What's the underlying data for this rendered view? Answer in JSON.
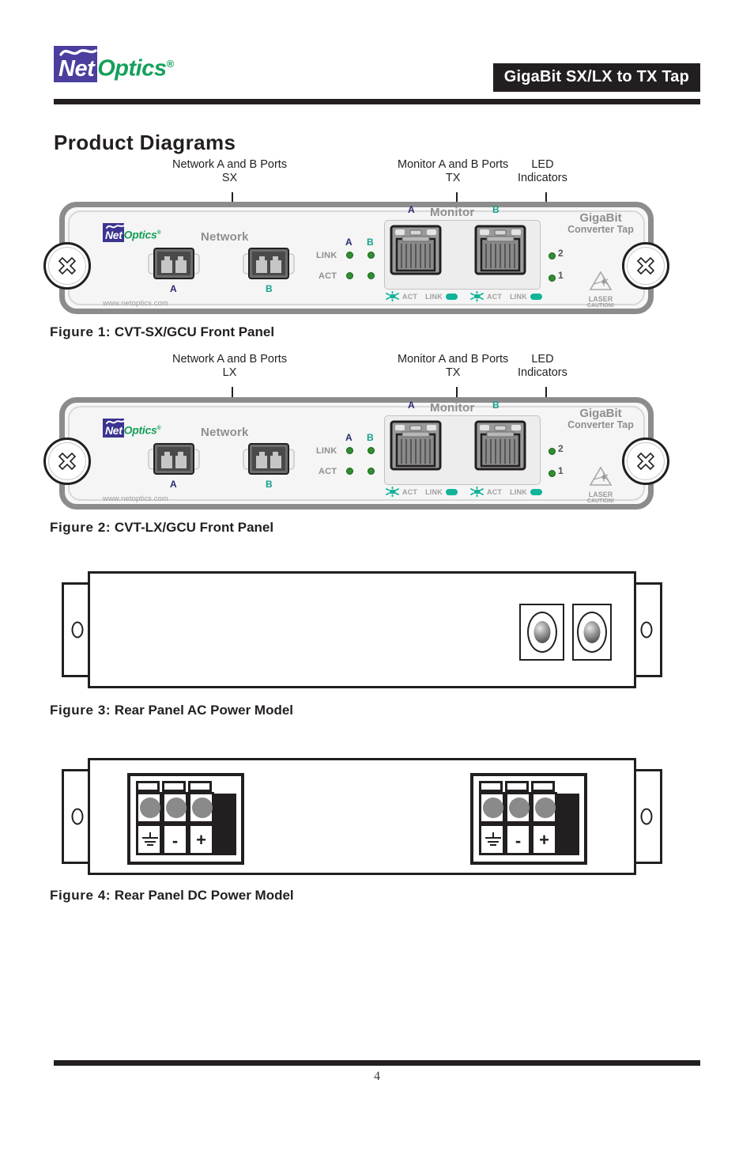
{
  "header": {
    "logo_net": "Net",
    "logo_optics": "Optics",
    "logo_registered": "®",
    "title": "GigaBit SX/LX to TX Tap"
  },
  "section": {
    "title": "Product Diagrams"
  },
  "figure1": {
    "callouts": {
      "network_ports": "Network A and B Ports",
      "network_type": "SX",
      "monitor_ports": "Monitor A and B Ports",
      "monitor_type": "TX",
      "led_line1": "LED",
      "led_line2": "Indicators"
    },
    "panel": {
      "logo_net": "Net",
      "logo_optics": "Optics",
      "logo_registered": "®",
      "network_label": "Network",
      "monitor_label": "Monitor",
      "brand_line1": "GigaBit",
      "brand_line2": "Converter Tap",
      "website": "www.netoptics.com",
      "port_a": "A",
      "port_b": "B",
      "monitor_a": "A",
      "monitor_b": "B",
      "led_col_a": "A",
      "led_col_b": "B",
      "led_link": "LINK",
      "led_act": "ACT",
      "power_led_2": "2",
      "power_led_1": "1",
      "tx_act": "ACT",
      "tx_link": "LINK",
      "laser_line1": "LASER",
      "laser_line2": "CAUTION!"
    },
    "caption_number": "Figure 1:",
    "caption_text": "CVT-SX/GCU Front Panel"
  },
  "figure2": {
    "callouts": {
      "network_ports": "Network A and B Ports",
      "network_type": "LX",
      "monitor_ports": "Monitor A and B Ports",
      "monitor_type": "TX",
      "led_line1": "LED",
      "led_line2": "Indicators"
    },
    "panel": {
      "logo_net": "Net",
      "logo_optics": "Optics",
      "logo_registered": "®",
      "network_label": "Network",
      "monitor_label": "Monitor",
      "brand_line1": "GigaBit",
      "brand_line2": "Converter Tap",
      "website": "www.netoptics.com",
      "port_a": "A",
      "port_b": "B",
      "monitor_a": "A",
      "monitor_b": "B",
      "led_col_a": "A",
      "led_col_b": "B",
      "led_link": "LINK",
      "led_act": "ACT",
      "power_led_2": "2",
      "power_led_1": "1",
      "tx_act": "ACT",
      "tx_link": "LINK",
      "laser_line1": "LASER",
      "laser_line2": "CAUTION!"
    },
    "caption_number": "Figure 2:",
    "caption_text": "CVT-LX/GCU Front Panel"
  },
  "figure3": {
    "caption_number": "Figure 3:",
    "caption_text": "Rear Panel AC Power Model"
  },
  "figure4": {
    "caption_number": "Figure 4:",
    "caption_text": "Rear Panel DC Power Model",
    "terminal_symbols": {
      "ground": "ground-symbol",
      "negative": "-",
      "positive": "+"
    }
  },
  "footer": {
    "page_number": "4"
  },
  "colors": {
    "brand_purple": "#4a3f9e",
    "brand_green": "#15a05a",
    "label_a": "#2b2a72",
    "label_b": "#15a08c",
    "led_green": "#2f8f2f",
    "teal_chip": "#11b39a",
    "ink": "#231f20"
  }
}
